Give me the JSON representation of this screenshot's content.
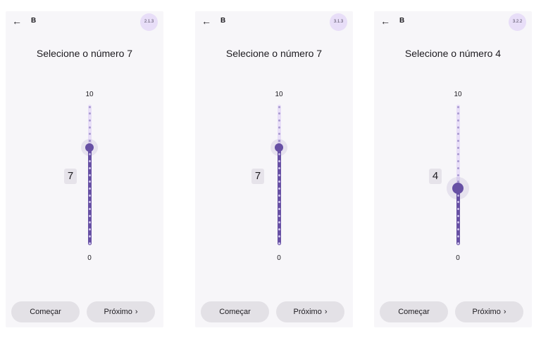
{
  "screens": [
    {
      "app_letter": "B",
      "badge": "2.1.3",
      "prompt": "Selecione o número 7",
      "max_label": "10",
      "min_label": "0",
      "value": 7,
      "value_display": "7",
      "start_label": "Começar",
      "next_label": "Próximo",
      "next_icon": "›"
    },
    {
      "app_letter": "B",
      "badge": "3.1.3",
      "prompt": "Selecione o número 7",
      "max_label": "10",
      "min_label": "0",
      "value": 7,
      "value_display": "7",
      "start_label": "Começar",
      "next_label": "Próximo",
      "next_icon": "›"
    },
    {
      "app_letter": "B",
      "badge": "3.2.2",
      "prompt": "Selecione o número 4",
      "max_label": "10",
      "min_label": "0",
      "value": 4,
      "value_display": "4",
      "start_label": "Começar",
      "next_label": "Próximo",
      "next_icon": "›"
    }
  ],
  "back_icon": "←",
  "colors": {
    "accent": "#6750a4",
    "track_inactive": "#e8def8",
    "badge_bg": "#e8def8",
    "button_bg": "#e3e1e6",
    "screen_bg": "#f7f6f9"
  }
}
